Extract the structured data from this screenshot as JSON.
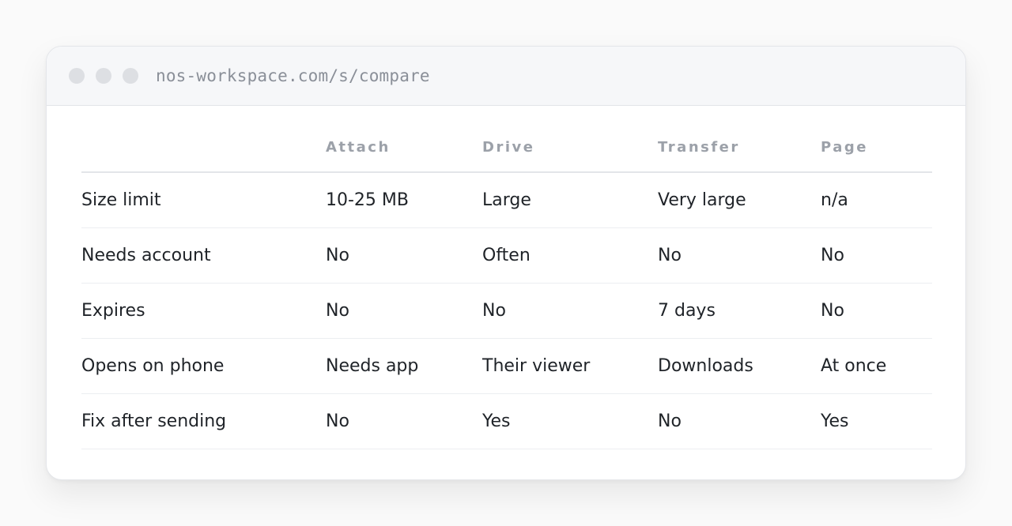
{
  "browser": {
    "url": "nos-workspace.com/s/compare"
  },
  "table": {
    "columns": [
      "",
      "Attach",
      "Drive",
      "Transfer",
      "Page"
    ],
    "rows": [
      {
        "label": "Size limit",
        "cells": [
          "10-25 MB",
          "Large",
          "Very large",
          "n/a"
        ]
      },
      {
        "label": "Needs account",
        "cells": [
          "No",
          "Often",
          "No",
          "No"
        ]
      },
      {
        "label": "Expires",
        "cells": [
          "No",
          "No",
          "7 days",
          "No"
        ]
      },
      {
        "label": "Opens on phone",
        "cells": [
          "Needs app",
          "Their viewer",
          "Downloads",
          "At once"
        ]
      },
      {
        "label": "Fix after sending",
        "cells": [
          "No",
          "Yes",
          "No",
          "Yes"
        ]
      }
    ]
  }
}
